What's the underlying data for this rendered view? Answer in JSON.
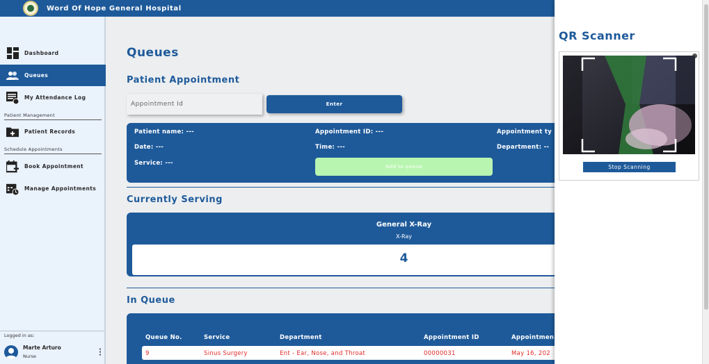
{
  "app": {
    "title": "Word Of Hope General Hospital"
  },
  "sidebar": {
    "items": [
      {
        "label": "Dashboard",
        "icon": "dashboard-icon"
      },
      {
        "label": "Queues",
        "icon": "users-icon",
        "active": true
      },
      {
        "label": "My Attendance Log",
        "icon": "attendance-log-icon"
      },
      {
        "label": "Patient Records",
        "icon": "folder-add-icon"
      },
      {
        "label": "Book Appointment",
        "icon": "calendar-add-icon"
      },
      {
        "label": "Manage Appointments",
        "icon": "calendar-clock-icon"
      }
    ],
    "sections": [
      "Patient Management",
      "Schedule Appointments"
    ],
    "user": {
      "logged_in_label": "Logged in as:",
      "name": "Marte Arturo",
      "role": "Nurse"
    }
  },
  "main": {
    "title": "Queues",
    "appointment": {
      "heading": "Patient Appointment",
      "input_placeholder": "Appointment Id",
      "enter_label": "Enter",
      "fields": {
        "patient_name": "Patient name: ---",
        "appointment_id": "Appointment ID: ---",
        "appointment_type": "Appointment ty",
        "date": "Date: ---",
        "time": "Time: ---",
        "department": "Department: --",
        "service": "Service: ---"
      },
      "add_label": "Add to queue"
    },
    "serving": {
      "heading": "Currently Serving",
      "name": "General X-Ray",
      "type": "X-Ray",
      "number": "4"
    },
    "queue": {
      "heading": "In Queue",
      "headers": [
        "Queue No.",
        "Service",
        "Department",
        "Appointment ID",
        "Appointmen"
      ],
      "rows": [
        {
          "queue_no": "9",
          "service": "Sinus Surgery",
          "department": "Ent - Ear, Nose, and Throat",
          "appointment_id": "00000031",
          "date": "May 16, 202"
        }
      ]
    }
  },
  "qr": {
    "title": "QR Scanner",
    "stop_label": "Stop Scanning"
  },
  "colors": {
    "primary": "#1e5a9a",
    "success_light": "#b8f5b0",
    "queue_text": "#e02828"
  }
}
